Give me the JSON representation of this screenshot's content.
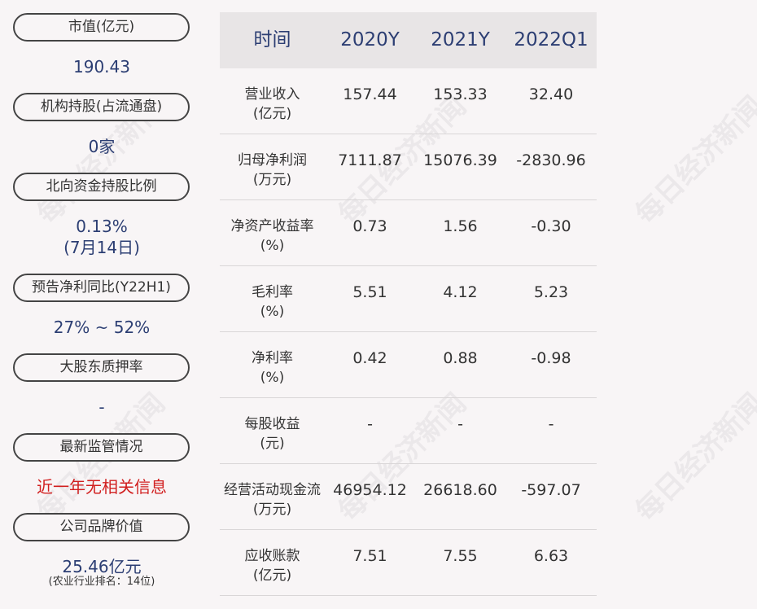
{
  "left_panel": {
    "items": [
      {
        "label": "市值(亿元)",
        "value": "190.43"
      },
      {
        "label": "机构持股(占流通盘)",
        "value": "0家"
      },
      {
        "label": "北向资金持股比例",
        "value": "0.13%",
        "value_line2": "(7月14日)"
      },
      {
        "label": "预告净利同比(Y22H1)",
        "value": "27% ~ 52%"
      },
      {
        "label": "大股东质押率",
        "value": "-"
      },
      {
        "label": "最新监管情况",
        "value": "近一年无相关信息"
      },
      {
        "label": "公司品牌价值",
        "value": "25.46亿元",
        "value_sub": "(农业行业排名：14位)"
      }
    ]
  },
  "table": {
    "headers": [
      "时间",
      "2020Y",
      "2021Y",
      "2022Q1"
    ],
    "rows": [
      {
        "label": "营业收入\n(亿元)",
        "values": [
          "157.44",
          "153.33",
          "32.40"
        ]
      },
      {
        "label": "归母净利润\n(万元)",
        "values": [
          "7111.87",
          "15076.39",
          "-2830.96"
        ]
      },
      {
        "label": "净资产收益率\n(%)",
        "values": [
          "0.73",
          "1.56",
          "-0.30"
        ]
      },
      {
        "label": "毛利率\n(%)",
        "values": [
          "5.51",
          "4.12",
          "5.23"
        ]
      },
      {
        "label": "净利率\n(%)",
        "values": [
          "0.42",
          "0.88",
          "-0.98"
        ]
      },
      {
        "label": "每股收益\n(元)",
        "values": [
          "-",
          "-",
          "-"
        ]
      },
      {
        "label": "经营活动现金流\n(万元)",
        "values": [
          "46954.12",
          "26618.60",
          "-597.07"
        ]
      },
      {
        "label": "应收账款\n(亿元)",
        "values": [
          "7.51",
          "7.55",
          "6.63"
        ]
      }
    ]
  },
  "watermark": "每日经济新闻",
  "colors": {
    "value_blue": "#2c3e73",
    "alert_red": "#d11f1f",
    "header_bg": "#e8e5e6"
  }
}
